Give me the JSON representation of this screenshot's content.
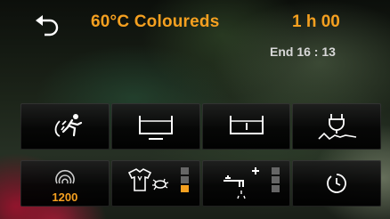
{
  "header": {
    "program_name": "60°C Coloureds",
    "duration": "1 h 00",
    "end_time": "End 16 : 13"
  },
  "row1": [
    {
      "name": "speed-program",
      "icon": "running-figure-icon"
    },
    {
      "name": "water-level-low",
      "icon": "tub-icon"
    },
    {
      "name": "water-level",
      "icon": "tub-icon"
    },
    {
      "name": "wrinkle-guard",
      "icon": "iron-wave-icon"
    }
  ],
  "row2": {
    "spin": {
      "icon": "spin-icon",
      "value": "1200"
    },
    "soil": {
      "icon": "shirt-stain-icon",
      "level": 1,
      "max": 3
    },
    "rinse": {
      "icon": "tap-plus-icon",
      "level": 0,
      "max": 3
    },
    "delay": {
      "icon": "clock-icon"
    }
  },
  "colors": {
    "accent": "#f5a020",
    "text_secondary": "#d8d8d8"
  }
}
